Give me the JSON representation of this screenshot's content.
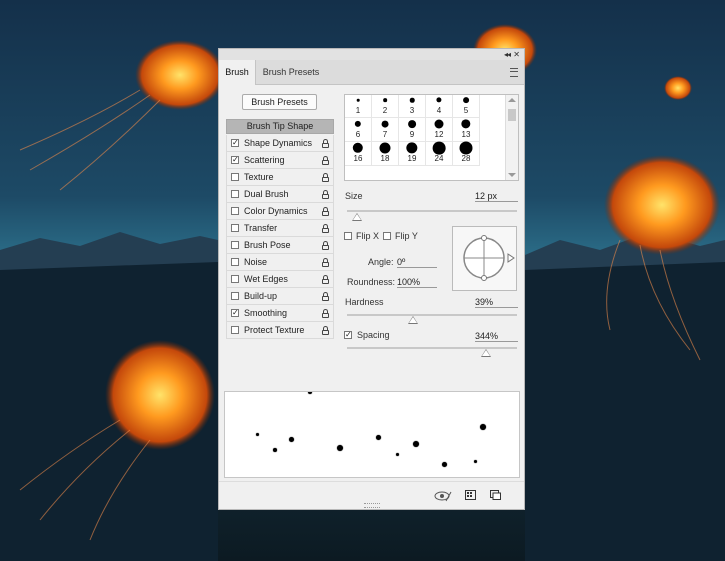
{
  "panel": {
    "tabs": [
      {
        "label": "Brush",
        "active": true
      },
      {
        "label": "Brush Presets",
        "active": false
      }
    ],
    "brush_presets_button": "Brush Presets",
    "brush_tip_shape_label": "Brush Tip Shape",
    "options": [
      {
        "label": "Shape Dynamics",
        "checked": true
      },
      {
        "label": "Scattering",
        "checked": true
      },
      {
        "label": "Texture",
        "checked": false
      },
      {
        "label": "Dual Brush",
        "checked": false
      },
      {
        "label": "Color Dynamics",
        "checked": false
      },
      {
        "label": "Transfer",
        "checked": false
      },
      {
        "label": "Brush Pose",
        "checked": false
      },
      {
        "label": "Noise",
        "checked": false
      },
      {
        "label": "Wet Edges",
        "checked": false
      },
      {
        "label": "Build-up",
        "checked": false
      },
      {
        "label": "Smoothing",
        "checked": true
      },
      {
        "label": "Protect Texture",
        "checked": false
      }
    ],
    "brush_tips": [
      {
        "size": "1"
      },
      {
        "size": "2"
      },
      {
        "size": "3"
      },
      {
        "size": "4"
      },
      {
        "size": "5"
      },
      {
        "size": "6"
      },
      {
        "size": "7"
      },
      {
        "size": "9"
      },
      {
        "size": "12"
      },
      {
        "size": "13"
      },
      {
        "size": "16"
      },
      {
        "size": "18"
      },
      {
        "size": "19"
      },
      {
        "size": "24"
      },
      {
        "size": "28"
      }
    ],
    "size": {
      "label": "Size",
      "value": "12 px",
      "slider_fraction": 0.06
    },
    "flip_x": {
      "label": "Flip X",
      "checked": false
    },
    "flip_y": {
      "label": "Flip Y",
      "checked": false
    },
    "angle": {
      "label": "Angle:",
      "value": "0º"
    },
    "roundness": {
      "label": "Roundness:",
      "value": "100%"
    },
    "hardness": {
      "label": "Hardness",
      "value": "39%",
      "slider_fraction": 0.39
    },
    "spacing": {
      "label": "Spacing",
      "value": "344%",
      "checked": true,
      "slider_fraction": 0.82
    }
  }
}
